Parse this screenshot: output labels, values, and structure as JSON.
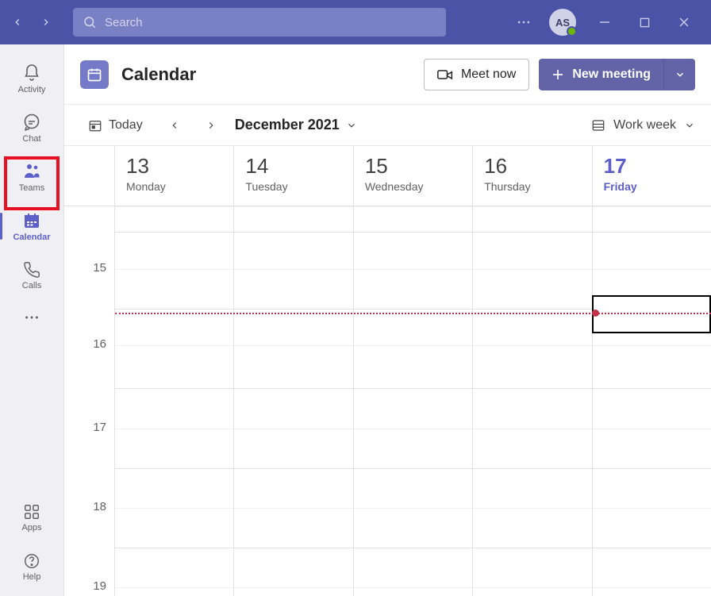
{
  "titlebar": {
    "search_placeholder": "Search",
    "avatar_initials": "AS"
  },
  "rail": {
    "activity": "Activity",
    "chat": "Chat",
    "teams": "Teams",
    "calendar": "Calendar",
    "calls": "Calls",
    "apps": "Apps",
    "help": "Help"
  },
  "header": {
    "title": "Calendar",
    "meet_now": "Meet now",
    "new_meeting": "New meeting"
  },
  "controls": {
    "today": "Today",
    "month": "December 2021",
    "view": "Work week"
  },
  "days": [
    {
      "num": "13",
      "wd": "Monday"
    },
    {
      "num": "14",
      "wd": "Tuesday"
    },
    {
      "num": "15",
      "wd": "Wednesday"
    },
    {
      "num": "16",
      "wd": "Thursday"
    },
    {
      "num": "17",
      "wd": "Friday"
    }
  ],
  "hours": [
    "15",
    "16",
    "17",
    "18",
    "19"
  ]
}
